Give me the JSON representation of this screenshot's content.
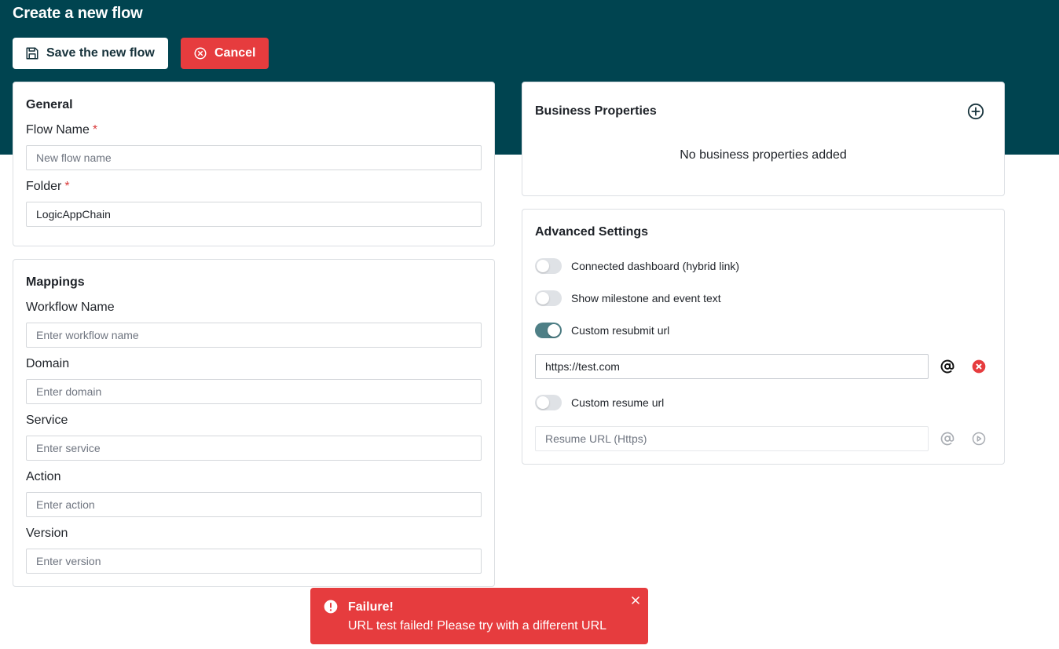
{
  "page": {
    "title": "Create a new flow"
  },
  "toolbar": {
    "save_label": "Save the new flow",
    "save_icon": "floppy-disk-icon",
    "cancel_label": "Cancel",
    "cancel_icon": "circle-x-icon"
  },
  "general": {
    "title": "General",
    "flow_name": {
      "label": "Flow Name",
      "required_mark": "*",
      "value": "",
      "placeholder": "New flow name"
    },
    "folder": {
      "label": "Folder",
      "required_mark": "*",
      "value": "LogicAppChain",
      "placeholder": ""
    }
  },
  "mappings": {
    "title": "Mappings",
    "fields": [
      {
        "label": "Workflow Name",
        "value": "",
        "placeholder": "Enter workflow name"
      },
      {
        "label": "Domain",
        "value": "",
        "placeholder": "Enter domain"
      },
      {
        "label": "Service",
        "value": "",
        "placeholder": "Enter service"
      },
      {
        "label": "Action",
        "value": "",
        "placeholder": "Enter action"
      },
      {
        "label": "Version",
        "value": "",
        "placeholder": "Enter version"
      }
    ]
  },
  "business_properties": {
    "title": "Business Properties",
    "empty_text": "No business properties added",
    "add_icon": "circle-plus-icon"
  },
  "advanced_settings": {
    "title": "Advanced Settings",
    "toggles": [
      {
        "label": "Connected dashboard (hybrid link)",
        "on": false
      },
      {
        "label": "Show milestone and event text",
        "on": false
      },
      {
        "label": "Custom resubmit url",
        "on": true
      },
      {
        "label": "Custom resume url",
        "on": false
      }
    ],
    "resubmit_url": {
      "value": "https://test.com",
      "placeholder": ""
    },
    "resume_url": {
      "value": "",
      "placeholder": "Resume URL (Https)"
    }
  },
  "toast": {
    "title": "Failure!",
    "message": "URL test failed! Please try with a different URL",
    "icon": "exclamation-circle-icon",
    "close_icon": "close-icon"
  },
  "colors": {
    "header": "#004450",
    "danger": "#e63c3e",
    "toggle_on": "#4e7f86"
  }
}
